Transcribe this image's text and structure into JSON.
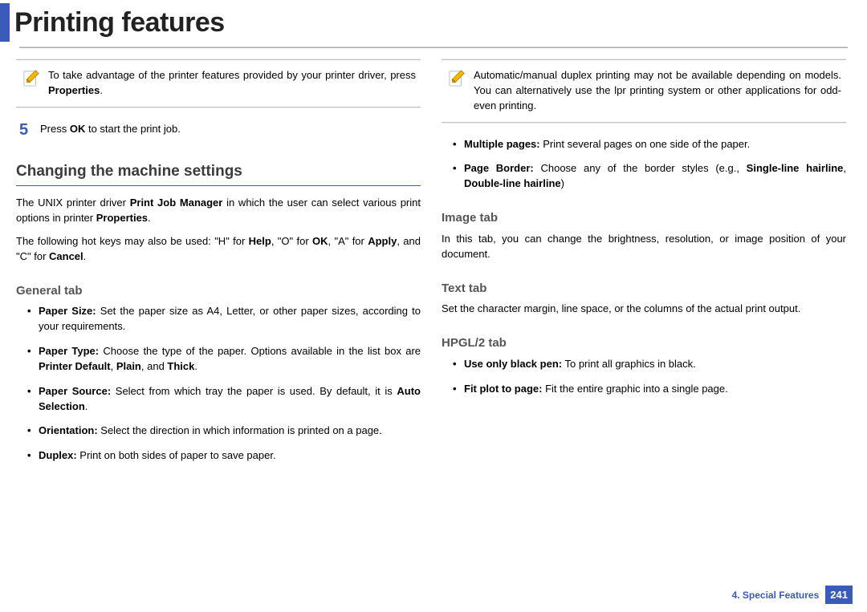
{
  "header": {
    "title": "Printing features"
  },
  "left": {
    "note": {
      "p1a": "To take advantage of the printer features provided by your printer driver, press ",
      "p1b": "Properties",
      "p1c": "."
    },
    "step5": {
      "num": "5",
      "a": "Press ",
      "b": "OK",
      "c": " to start the print job."
    },
    "h2": "Changing the machine settings",
    "p1": {
      "a": "The UNIX printer driver ",
      "b": "Print Job Manager",
      "c": " in which the user can select various print options in printer ",
      "d": "Properties",
      "e": "."
    },
    "p2": {
      "a": "The following hot keys may also be used: \"H\" for ",
      "b": "Help",
      "c": ", \"O\" for ",
      "d": "OK",
      "e": ", \"A\" for ",
      "f": "Apply",
      "g": ", and \"C\" for ",
      "h": "Cancel",
      "i": "."
    },
    "h3_general": "General tab",
    "general": {
      "i1": {
        "a": "Paper Size:",
        "b": " Set the paper size as A4, Letter, or other paper sizes, according to your requirements."
      },
      "i2": {
        "a": "Paper Type:",
        "b": " Choose the type of the paper. Options available in the list box are ",
        "c": "Printer Default",
        "d": ", ",
        "e": "Plain",
        "f": ", and ",
        "g": "Thick",
        "h": "."
      },
      "i3": {
        "a": "Paper Source:",
        "b": " Select from which tray the paper is used. By default, it is ",
        "c": "Auto Selection",
        "d": "."
      },
      "i4": {
        "a": "Orientation:",
        "b": " Select the direction in which information is printed on a page."
      },
      "i5": {
        "a": "Duplex:",
        "b": " Print on both sides of paper to save paper."
      }
    }
  },
  "right": {
    "note": {
      "p1": "Automatic/manual duplex printing may not be available depending on models. You can alternatively use the lpr printing system or other applications for odd-even printing."
    },
    "top_bullets": {
      "i1": {
        "a": "Multiple pages:",
        "b": " Print several pages on one side of the paper."
      },
      "i2": {
        "a": "Page Border:",
        "b": " Choose any of the border styles (e.g., ",
        "c": "Single-line hairline",
        "d": ", ",
        "e": "Double-line hairline",
        "f": ")"
      }
    },
    "h3_image": "Image tab",
    "image_p": "In this tab, you can change the brightness, resolution, or image position of your document.",
    "h3_text": "Text tab",
    "text_p": "Set the character margin, line space, or the columns of the actual print output.",
    "h3_hpgl": "HPGL/2 tab",
    "hpgl": {
      "i1": {
        "a": "Use only black pen:",
        "b": " To print all graphics in black."
      },
      "i2": {
        "a": "Fit plot to page:",
        "b": " Fit the entire graphic into a single page."
      }
    }
  },
  "footer": {
    "section": "4.  Special Features",
    "page": "241"
  }
}
